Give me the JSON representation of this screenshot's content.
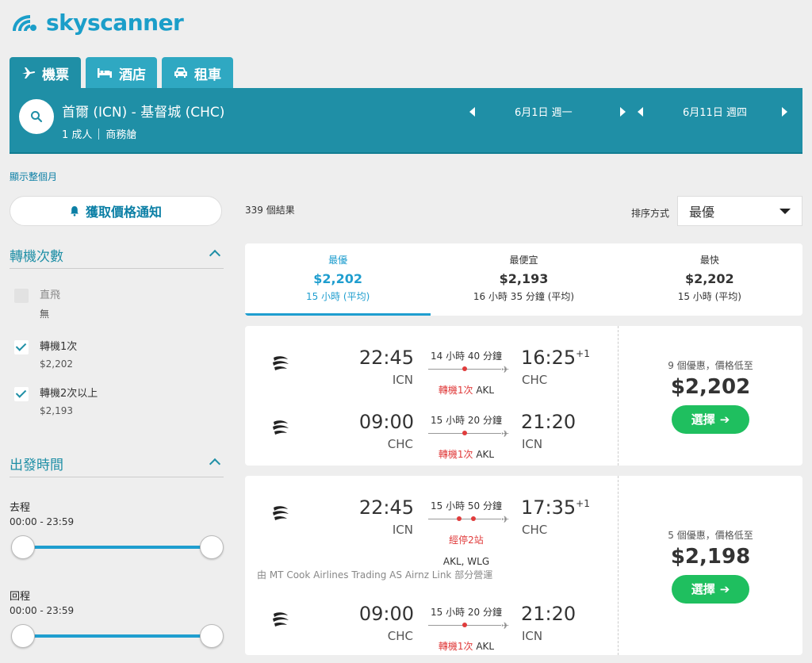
{
  "brand": {
    "name": "skyscanner",
    "color": "#1b9ec9"
  },
  "tabs": [
    {
      "label": "機票",
      "icon": "plane-icon",
      "active": true
    },
    {
      "label": "酒店",
      "icon": "bed-icon",
      "active": false
    },
    {
      "label": "租車",
      "icon": "car-icon",
      "active": false
    }
  ],
  "search": {
    "route": "首爾 (ICN) - 基督城 (CHC)",
    "passengers": "1 成人",
    "cabin": "商務艙",
    "depart_date": "6月1日 週一",
    "return_date": "6月11日 週四"
  },
  "show_month": "顯示整個月",
  "price_alert": "獲取價格通知",
  "filters": {
    "stops": {
      "title": "轉機次數",
      "options": [
        {
          "label": "直飛",
          "sub": "無",
          "checked": false,
          "disabled": true
        },
        {
          "label": "轉機1次",
          "sub": "$2,202",
          "checked": true,
          "disabled": false
        },
        {
          "label": "轉機2次以上",
          "sub": "$2,193",
          "checked": true,
          "disabled": false
        }
      ]
    },
    "departure": {
      "title": "出發時間",
      "outbound_label": "去程",
      "outbound_range": "00:00 - 23:59",
      "return_label": "回程",
      "return_range": "00:00 - 23:59"
    }
  },
  "results_count": "339 個結果",
  "sort": {
    "label": "排序方式",
    "selected": "最優"
  },
  "sort_tabs": [
    {
      "title": "最優",
      "price": "$2,202",
      "duration": "15 小時 (平均)",
      "active": true
    },
    {
      "title": "最便宜",
      "price": "$2,193",
      "duration": "16 小時 35 分鐘 (平均)",
      "active": false
    },
    {
      "title": "最快",
      "price": "$2,202",
      "duration": "15 小時 (平均)",
      "active": false
    }
  ],
  "results": [
    {
      "deals": "9 個優惠，價格低至",
      "price": "$2,202",
      "select_label": "選擇",
      "legs": [
        {
          "dep_time": "22:45",
          "dep_code": "ICN",
          "duration": "14 小時 40 分鐘",
          "stops": "轉機1次",
          "via": "AKL",
          "arr_time": "16:25",
          "day_offset": "+1",
          "arr_code": "CHC"
        },
        {
          "dep_time": "09:00",
          "dep_code": "CHC",
          "duration": "15 小時 20 分鐘",
          "stops": "轉機1次",
          "via": "AKL",
          "arr_time": "21:20",
          "day_offset": "",
          "arr_code": "ICN"
        }
      ]
    },
    {
      "deals": "5 個優惠，價格低至",
      "price": "$2,198",
      "select_label": "選擇",
      "operated_by": "由 MT Cook Airlines Trading AS Airnz Link 部分營運",
      "legs": [
        {
          "dep_time": "22:45",
          "dep_code": "ICN",
          "duration": "15 小時 50 分鐘",
          "stops": "經停2站",
          "via": "AKL, WLG",
          "arr_time": "17:35",
          "day_offset": "+1",
          "arr_code": "CHC"
        },
        {
          "dep_time": "09:00",
          "dep_code": "CHC",
          "duration": "15 小時 20 分鐘",
          "stops": "轉機1次",
          "via": "AKL",
          "arr_time": "21:20",
          "day_offset": "",
          "arr_code": "ICN"
        }
      ]
    }
  ]
}
